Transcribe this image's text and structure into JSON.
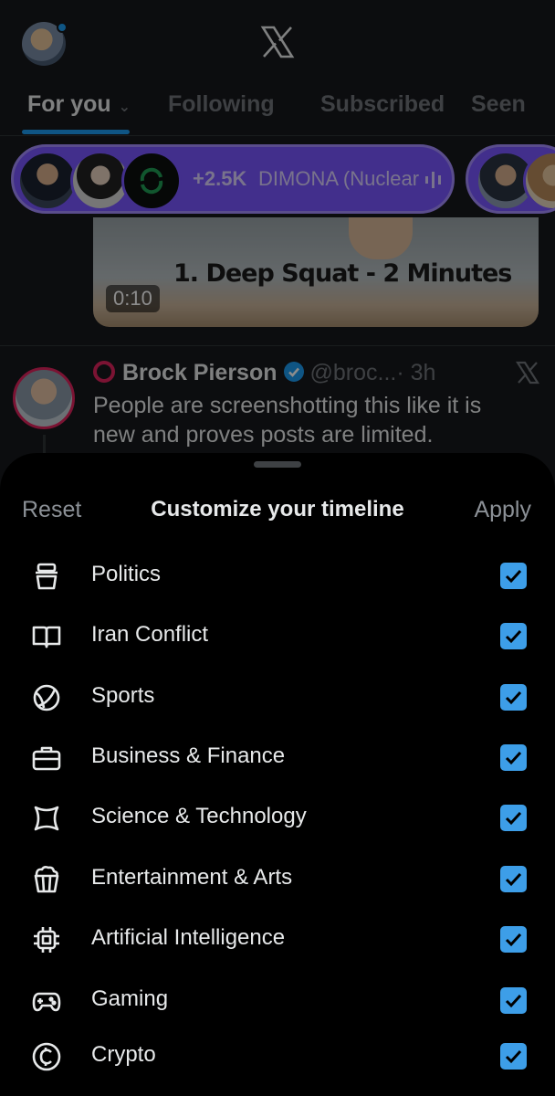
{
  "header": {
    "tabs": [
      {
        "label": "For you",
        "active": true
      },
      {
        "label": "Following",
        "active": false
      },
      {
        "label": "Subscribed",
        "active": false
      },
      {
        "label": "Seen",
        "active": false
      }
    ]
  },
  "spaces": {
    "listener_count": "+2.5K",
    "title": "DIMONA (Nuclear"
  },
  "video": {
    "caption": "1. Deep Squat - 2 Minutes",
    "duration": "0:10"
  },
  "post": {
    "author": "Brock Pierson",
    "handle": "@broc...",
    "time": "· 3h",
    "text": "People are screenshotting this like it is new and proves posts are limited."
  },
  "sheet": {
    "reset_label": "Reset",
    "title": "Customize your timeline",
    "apply_label": "Apply",
    "topics": [
      {
        "label": "Politics",
        "icon": "politics-icon",
        "checked": true
      },
      {
        "label": "Iran Conflict",
        "icon": "book-icon",
        "checked": true
      },
      {
        "label": "Sports",
        "icon": "sports-ball-icon",
        "checked": true
      },
      {
        "label": "Business & Finance",
        "icon": "briefcase-icon",
        "checked": true
      },
      {
        "label": "Science & Technology",
        "icon": "atom-icon",
        "checked": true
      },
      {
        "label": "Entertainment & Arts",
        "icon": "popcorn-icon",
        "checked": true
      },
      {
        "label": "Artificial Intelligence",
        "icon": "chip-icon",
        "checked": true
      },
      {
        "label": "Gaming",
        "icon": "gamepad-icon",
        "checked": true
      },
      {
        "label": "Crypto",
        "icon": "crypto-coin-icon",
        "checked": true
      }
    ]
  },
  "colors": {
    "accent": "#1d9bf0",
    "checkbox": "#3d9ee8",
    "spaces_purple": "#7856ff"
  }
}
